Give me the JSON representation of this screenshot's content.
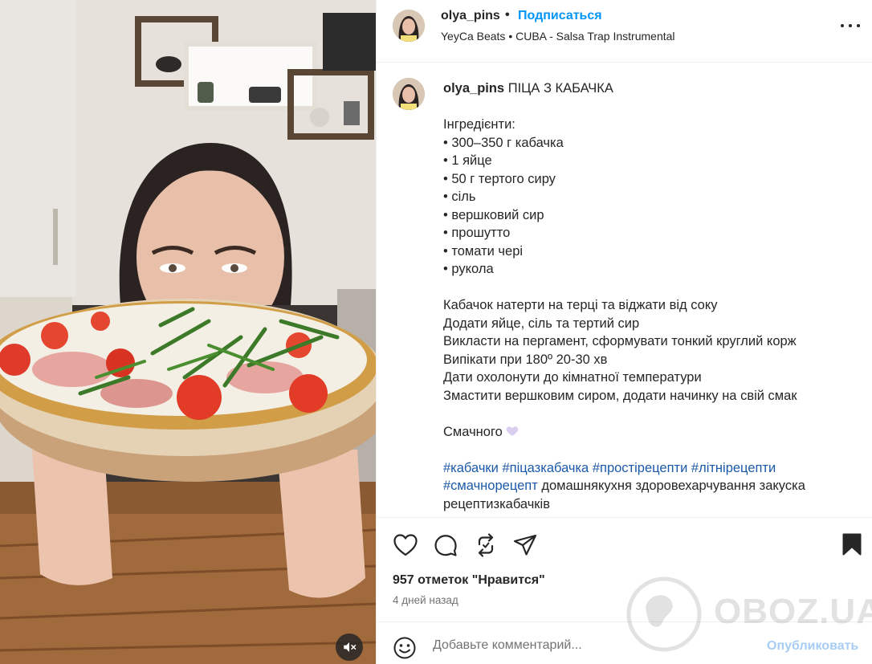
{
  "header": {
    "username": "olya_pins",
    "separator": "•",
    "follow_label": "Подписаться",
    "audio": "YeyCa Beats • CUBA - Salsa Trap Instrumental"
  },
  "caption": {
    "username": "olya_pins",
    "title": "ПІЦА З КАБАЧКА",
    "lines": [
      "",
      "Інгредієнти:",
      "• 300–350 г кабачка",
      "• 1 яйце",
      "• 50 г тертого сиру",
      "• сіль",
      "• вершковий сир",
      "• прошутто",
      "• томати чері",
      "• рукола",
      "",
      "Кабачок натерти на терці та віджати від соку",
      "Додати яйце, сіль та тертий сир",
      "Викласти на пергамент, сформувати тонкий круглий корж",
      "Випікати при 180º 20-30 хв",
      "Дати охолонути до кімнатної температури",
      "Змастити вершковим сиром, додати начинку на свій смак",
      ""
    ],
    "closing": "Смачного",
    "hashtags_line1": [
      "#кабачки",
      "#піцазкабачка",
      "#простірецепти",
      "#літнірецепти"
    ],
    "hashtag_line2": "#смачнорецепт",
    "plain_tags_line2": "домашнякухня здоровехарчування закуска",
    "plain_tags_line3": "рецептизкабачків"
  },
  "actions": {
    "likes_text": "957 отметок \"Нравится\"",
    "date_text": "4 дней назад"
  },
  "comment": {
    "placeholder": "Добавьте комментарий...",
    "post_label": "Опубликовать"
  },
  "watermark": {
    "text": "OBOZ.UA"
  },
  "colors": {
    "accent": "#0095f6",
    "hashtag": "#1c5aa8",
    "post_disabled": "#a8cdf4",
    "secondary_text": "#737373",
    "border": "#efefef"
  },
  "icons": {
    "like": "heart-outline-icon",
    "comment": "speech-bubble-icon",
    "repost": "repost-arrows-icon",
    "share": "paper-plane-icon",
    "save": "bookmark-filled-icon",
    "more": "ellipsis-icon",
    "emoji": "smiley-icon",
    "mute": "speaker-muted-icon"
  }
}
